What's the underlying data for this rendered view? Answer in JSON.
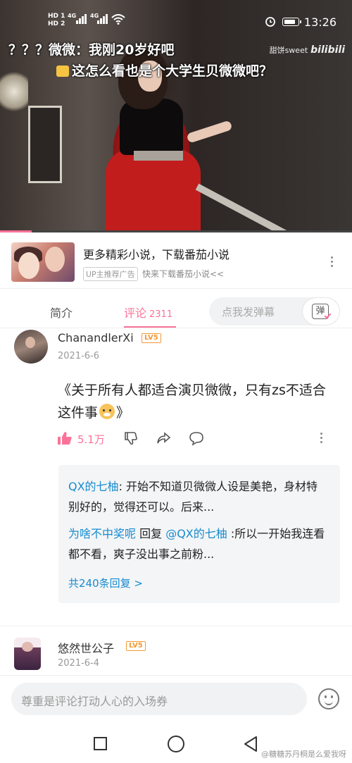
{
  "status_bar": {
    "sim1": "HD 1",
    "sim2": "HD 2",
    "net1": "4G",
    "net2": "4G",
    "time": "13:26",
    "battery_level": 0.85
  },
  "video": {
    "danmaku": [
      "？？？微微：我刚20岁好吧",
      "这怎么看也是个大学生贝微微吧？"
    ],
    "watermark_text": "甜饼sweet",
    "watermark_logo": "bilibili",
    "progress": 0.09
  },
  "ad": {
    "title": "更多精彩小说，下载番茄小说",
    "tag": "UP主推荐广告",
    "subtitle": "快来下载番茄小说<<"
  },
  "tabs": {
    "intro": "简介",
    "comments": "评论",
    "comments_count": "2311",
    "danmaku_placeholder": "点我发弹幕",
    "danmaku_button": "弹"
  },
  "comments": [
    {
      "user": "ChanandlerXi",
      "level": "LV5",
      "date": "2021-6-6",
      "text": "《关于所有人都适合演贝微微，只有zs不适合这件事",
      "text_end": "》",
      "likes": "5.1万",
      "replies": [
        {
          "user": "QX的七柚",
          "text": ": 开始不知道贝微微人设是美艳，身材特别好的，觉得还可以。后来..."
        },
        {
          "user": "为啥不中奖呢",
          "mid": " 回复 ",
          "target": "@QX的七柚",
          "text": " :所以一开始我连看都不看，爽子没出事之前粉..."
        }
      ],
      "more_replies": "共240条回复 >"
    },
    {
      "user": "悠然世公子",
      "level": "LV5",
      "date": "2021-6-4"
    }
  ],
  "input_bar": {
    "placeholder": "尊重是评论打动人心的入场券"
  },
  "footer": {
    "watermark": "@糖糖苏丹桐是么爱我呀"
  },
  "colors": {
    "accent": "#fb7299",
    "link": "#178bcf",
    "level": "#f29a38"
  }
}
